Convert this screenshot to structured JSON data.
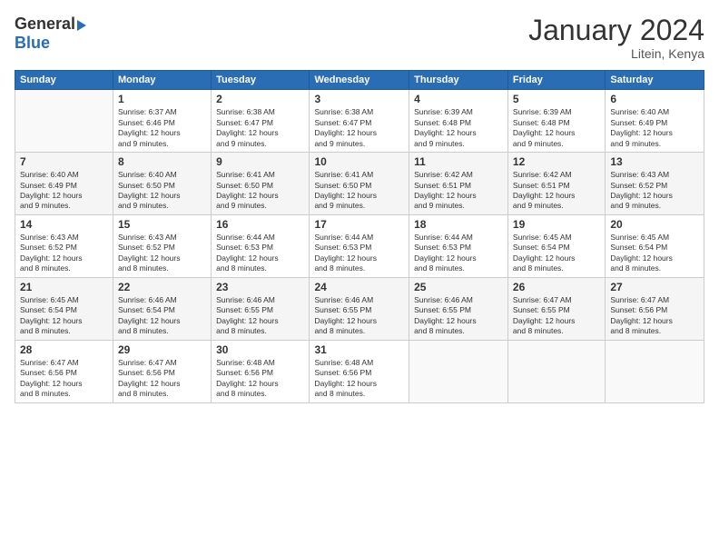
{
  "logo": {
    "general": "General",
    "blue": "Blue"
  },
  "title": "January 2024",
  "location": "Litein, Kenya",
  "headers": [
    "Sunday",
    "Monday",
    "Tuesday",
    "Wednesday",
    "Thursday",
    "Friday",
    "Saturday"
  ],
  "weeks": [
    [
      {
        "day": "",
        "sunrise": "",
        "sunset": "",
        "daylight": ""
      },
      {
        "day": "1",
        "sunrise": "Sunrise: 6:37 AM",
        "sunset": "Sunset: 6:46 PM",
        "daylight": "Daylight: 12 hours and 9 minutes."
      },
      {
        "day": "2",
        "sunrise": "Sunrise: 6:38 AM",
        "sunset": "Sunset: 6:47 PM",
        "daylight": "Daylight: 12 hours and 9 minutes."
      },
      {
        "day": "3",
        "sunrise": "Sunrise: 6:38 AM",
        "sunset": "Sunset: 6:47 PM",
        "daylight": "Daylight: 12 hours and 9 minutes."
      },
      {
        "day": "4",
        "sunrise": "Sunrise: 6:39 AM",
        "sunset": "Sunset: 6:48 PM",
        "daylight": "Daylight: 12 hours and 9 minutes."
      },
      {
        "day": "5",
        "sunrise": "Sunrise: 6:39 AM",
        "sunset": "Sunset: 6:48 PM",
        "daylight": "Daylight: 12 hours and 9 minutes."
      },
      {
        "day": "6",
        "sunrise": "Sunrise: 6:40 AM",
        "sunset": "Sunset: 6:49 PM",
        "daylight": "Daylight: 12 hours and 9 minutes."
      }
    ],
    [
      {
        "day": "7",
        "sunrise": "Sunrise: 6:40 AM",
        "sunset": "Sunset: 6:49 PM",
        "daylight": "Daylight: 12 hours and 9 minutes."
      },
      {
        "day": "8",
        "sunrise": "Sunrise: 6:40 AM",
        "sunset": "Sunset: 6:50 PM",
        "daylight": "Daylight: 12 hours and 9 minutes."
      },
      {
        "day": "9",
        "sunrise": "Sunrise: 6:41 AM",
        "sunset": "Sunset: 6:50 PM",
        "daylight": "Daylight: 12 hours and 9 minutes."
      },
      {
        "day": "10",
        "sunrise": "Sunrise: 6:41 AM",
        "sunset": "Sunset: 6:50 PM",
        "daylight": "Daylight: 12 hours and 9 minutes."
      },
      {
        "day": "11",
        "sunrise": "Sunrise: 6:42 AM",
        "sunset": "Sunset: 6:51 PM",
        "daylight": "Daylight: 12 hours and 9 minutes."
      },
      {
        "day": "12",
        "sunrise": "Sunrise: 6:42 AM",
        "sunset": "Sunset: 6:51 PM",
        "daylight": "Daylight: 12 hours and 9 minutes."
      },
      {
        "day": "13",
        "sunrise": "Sunrise: 6:43 AM",
        "sunset": "Sunset: 6:52 PM",
        "daylight": "Daylight: 12 hours and 9 minutes."
      }
    ],
    [
      {
        "day": "14",
        "sunrise": "Sunrise: 6:43 AM",
        "sunset": "Sunset: 6:52 PM",
        "daylight": "Daylight: 12 hours and 8 minutes."
      },
      {
        "day": "15",
        "sunrise": "Sunrise: 6:43 AM",
        "sunset": "Sunset: 6:52 PM",
        "daylight": "Daylight: 12 hours and 8 minutes."
      },
      {
        "day": "16",
        "sunrise": "Sunrise: 6:44 AM",
        "sunset": "Sunset: 6:53 PM",
        "daylight": "Daylight: 12 hours and 8 minutes."
      },
      {
        "day": "17",
        "sunrise": "Sunrise: 6:44 AM",
        "sunset": "Sunset: 6:53 PM",
        "daylight": "Daylight: 12 hours and 8 minutes."
      },
      {
        "day": "18",
        "sunrise": "Sunrise: 6:44 AM",
        "sunset": "Sunset: 6:53 PM",
        "daylight": "Daylight: 12 hours and 8 minutes."
      },
      {
        "day": "19",
        "sunrise": "Sunrise: 6:45 AM",
        "sunset": "Sunset: 6:54 PM",
        "daylight": "Daylight: 12 hours and 8 minutes."
      },
      {
        "day": "20",
        "sunrise": "Sunrise: 6:45 AM",
        "sunset": "Sunset: 6:54 PM",
        "daylight": "Daylight: 12 hours and 8 minutes."
      }
    ],
    [
      {
        "day": "21",
        "sunrise": "Sunrise: 6:45 AM",
        "sunset": "Sunset: 6:54 PM",
        "daylight": "Daylight: 12 hours and 8 minutes."
      },
      {
        "day": "22",
        "sunrise": "Sunrise: 6:46 AM",
        "sunset": "Sunset: 6:54 PM",
        "daylight": "Daylight: 12 hours and 8 minutes."
      },
      {
        "day": "23",
        "sunrise": "Sunrise: 6:46 AM",
        "sunset": "Sunset: 6:55 PM",
        "daylight": "Daylight: 12 hours and 8 minutes."
      },
      {
        "day": "24",
        "sunrise": "Sunrise: 6:46 AM",
        "sunset": "Sunset: 6:55 PM",
        "daylight": "Daylight: 12 hours and 8 minutes."
      },
      {
        "day": "25",
        "sunrise": "Sunrise: 6:46 AM",
        "sunset": "Sunset: 6:55 PM",
        "daylight": "Daylight: 12 hours and 8 minutes."
      },
      {
        "day": "26",
        "sunrise": "Sunrise: 6:47 AM",
        "sunset": "Sunset: 6:55 PM",
        "daylight": "Daylight: 12 hours and 8 minutes."
      },
      {
        "day": "27",
        "sunrise": "Sunrise: 6:47 AM",
        "sunset": "Sunset: 6:56 PM",
        "daylight": "Daylight: 12 hours and 8 minutes."
      }
    ],
    [
      {
        "day": "28",
        "sunrise": "Sunrise: 6:47 AM",
        "sunset": "Sunset: 6:56 PM",
        "daylight": "Daylight: 12 hours and 8 minutes."
      },
      {
        "day": "29",
        "sunrise": "Sunrise: 6:47 AM",
        "sunset": "Sunset: 6:56 PM",
        "daylight": "Daylight: 12 hours and 8 minutes."
      },
      {
        "day": "30",
        "sunrise": "Sunrise: 6:48 AM",
        "sunset": "Sunset: 6:56 PM",
        "daylight": "Daylight: 12 hours and 8 minutes."
      },
      {
        "day": "31",
        "sunrise": "Sunrise: 6:48 AM",
        "sunset": "Sunset: 6:56 PM",
        "daylight": "Daylight: 12 hours and 8 minutes."
      },
      {
        "day": "",
        "sunrise": "",
        "sunset": "",
        "daylight": ""
      },
      {
        "day": "",
        "sunrise": "",
        "sunset": "",
        "daylight": ""
      },
      {
        "day": "",
        "sunrise": "",
        "sunset": "",
        "daylight": ""
      }
    ]
  ]
}
